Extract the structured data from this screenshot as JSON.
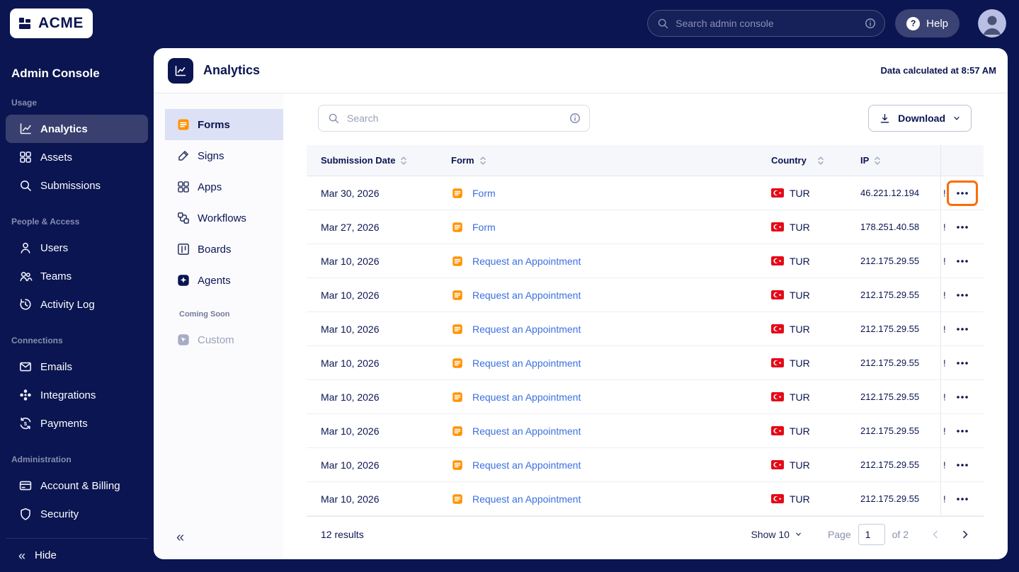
{
  "topbar": {
    "logo": "ACME",
    "search_placeholder": "Search admin console",
    "help_label": "Help",
    "help_icon": "?"
  },
  "sidebar": {
    "title": "Admin Console",
    "sections": [
      {
        "label": "Usage",
        "items": [
          {
            "label": "Analytics",
            "active": true
          },
          {
            "label": "Assets"
          },
          {
            "label": "Submissions"
          }
        ]
      },
      {
        "label": "People & Access",
        "items": [
          {
            "label": "Users"
          },
          {
            "label": "Teams"
          },
          {
            "label": "Activity Log"
          }
        ]
      },
      {
        "label": "Connections",
        "items": [
          {
            "label": "Emails"
          },
          {
            "label": "Integrations"
          },
          {
            "label": "Payments"
          }
        ]
      },
      {
        "label": "Administration",
        "items": [
          {
            "label": "Account & Billing"
          },
          {
            "label": "Security"
          }
        ]
      }
    ],
    "hide_label": "Hide"
  },
  "page": {
    "title": "Analytics",
    "calculated_note": "Data calculated at 8:57 AM"
  },
  "subnav": {
    "items": [
      {
        "label": "Forms",
        "active": true
      },
      {
        "label": "Signs"
      },
      {
        "label": "Apps"
      },
      {
        "label": "Workflows"
      },
      {
        "label": "Boards"
      },
      {
        "label": "Agents"
      }
    ],
    "coming_soon_label": "Coming Soon",
    "coming_soon_items": [
      {
        "label": "Custom"
      }
    ]
  },
  "toolbar": {
    "search_placeholder": "Search",
    "download_label": "Download"
  },
  "table": {
    "columns": [
      "Submission Date",
      "Form",
      "Country",
      "IP"
    ],
    "rows": [
      {
        "date": "Mar 30, 2026",
        "form": "Form",
        "country": "TUR",
        "ip": "46.221.12.194",
        "clipped": "!",
        "highlight": true
      },
      {
        "date": "Mar 27, 2026",
        "form": "Form",
        "country": "TUR",
        "ip": "178.251.40.58",
        "clipped": "!"
      },
      {
        "date": "Mar 10, 2026",
        "form": "Request an Appointment",
        "country": "TUR",
        "ip": "212.175.29.55",
        "clipped": "!"
      },
      {
        "date": "Mar 10, 2026",
        "form": "Request an Appointment",
        "country": "TUR",
        "ip": "212.175.29.55",
        "clipped": "!"
      },
      {
        "date": "Mar 10, 2026",
        "form": "Request an Appointment",
        "country": "TUR",
        "ip": "212.175.29.55",
        "clipped": "!"
      },
      {
        "date": "Mar 10, 2026",
        "form": "Request an Appointment",
        "country": "TUR",
        "ip": "212.175.29.55",
        "clipped": "!"
      },
      {
        "date": "Mar 10, 2026",
        "form": "Request an Appointment",
        "country": "TUR",
        "ip": "212.175.29.55",
        "clipped": "!"
      },
      {
        "date": "Mar 10, 2026",
        "form": "Request an Appointment",
        "country": "TUR",
        "ip": "212.175.29.55",
        "clipped": "!"
      },
      {
        "date": "Mar 10, 2026",
        "form": "Request an Appointment",
        "country": "TUR",
        "ip": "212.175.29.55",
        "clipped": "!"
      },
      {
        "date": "Mar 10, 2026",
        "form": "Request an Appointment",
        "country": "TUR",
        "ip": "212.175.29.55",
        "clipped": "!"
      }
    ]
  },
  "pagination": {
    "results": "12 results",
    "show_label": "Show 10",
    "page_label": "Page",
    "page_value": "1",
    "of_label": "of 2"
  },
  "colors": {
    "navy": "#0a1551",
    "link_blue": "#3b6fe0",
    "forms_orange": "#ff9300",
    "highlight_orange": "#ff6b00",
    "flag_red": "#e30a17",
    "active_lavender": "#dde1f5"
  }
}
